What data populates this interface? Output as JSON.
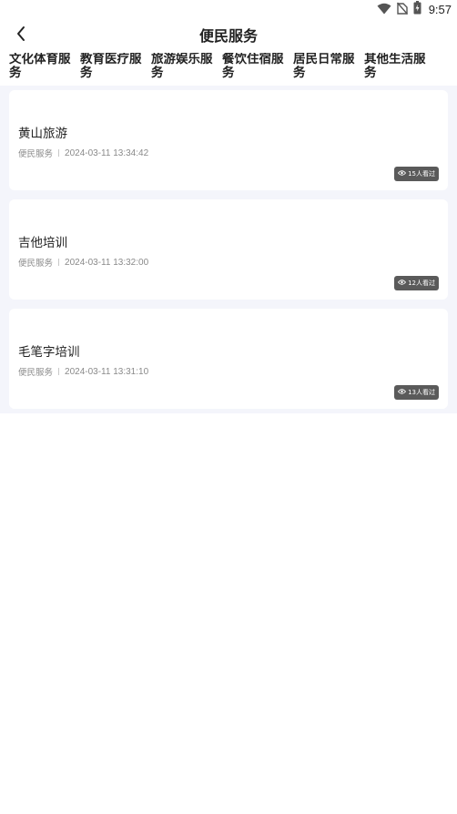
{
  "status_bar": {
    "time": "9:57",
    "icons": [
      "wifi-icon",
      "no-sim-icon",
      "battery-icon"
    ]
  },
  "header": {
    "title": "便民服务",
    "back_icon": "chevron-left-icon"
  },
  "tabs": [
    {
      "label": "文化体育服务"
    },
    {
      "label": "教育医疗服务"
    },
    {
      "label": "旅游娱乐服务"
    },
    {
      "label": "餐饮住宿服务"
    },
    {
      "label": "居民日常服务"
    },
    {
      "label": "其他生活服务"
    }
  ],
  "articles": [
    {
      "title": "黄山旅游",
      "category": "便民服务",
      "datetime": "2024-03-11 13:34:42",
      "views": "15人看过"
    },
    {
      "title": "吉他培训",
      "category": "便民服务",
      "datetime": "2024-03-11 13:32:00",
      "views": "12人看过"
    },
    {
      "title": "毛笔字培训",
      "category": "便民服务",
      "datetime": "2024-03-11 13:31:10",
      "views": "13人看过"
    }
  ],
  "colors": {
    "page_bg": "#ffffff",
    "list_bg": "#f4f5fb",
    "card_bg": "#ffffff",
    "badge_bg": "#5a5a5a",
    "meta_text": "#8a8a8a",
    "primary_text": "#222222"
  }
}
